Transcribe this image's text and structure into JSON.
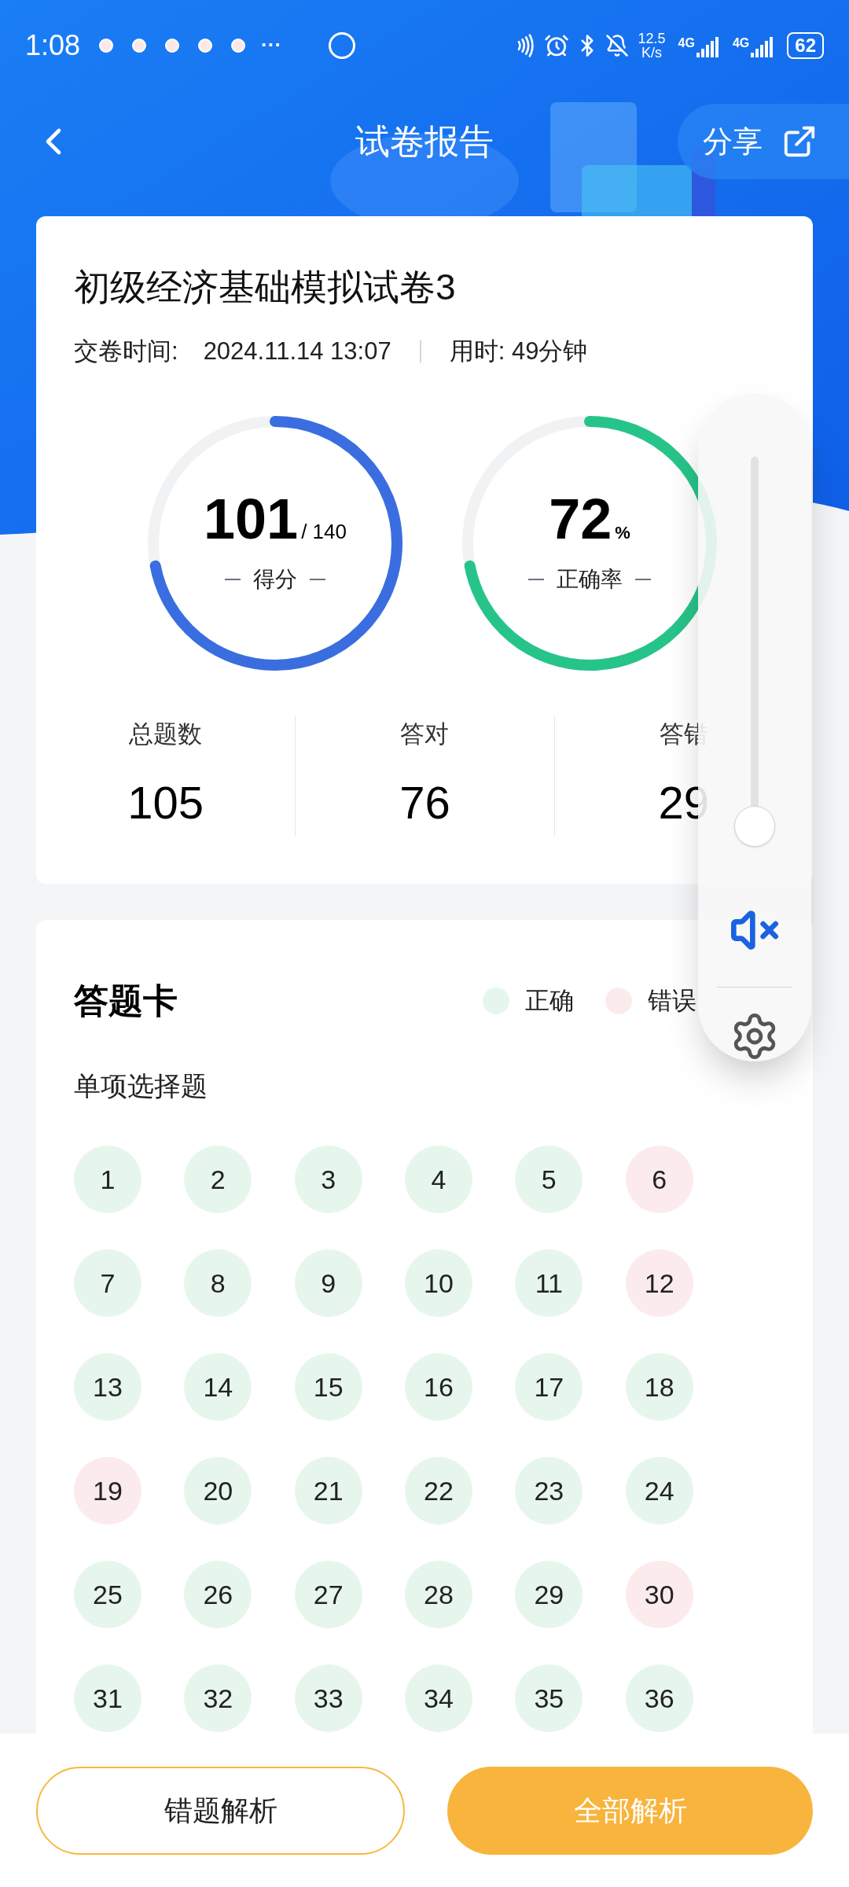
{
  "status_bar": {
    "time": "1:08",
    "more": "···",
    "speed_value": "12.5",
    "speed_unit": "K/s",
    "networks": [
      "4G",
      "4G"
    ],
    "battery": "62"
  },
  "header": {
    "title": "试卷报告",
    "share": "分享"
  },
  "report": {
    "title": "初级经济基础模拟试卷3",
    "submit_label": "交卷时间:",
    "submit_time": "2024.11.14 13:07",
    "duration": "用时: 49分钟",
    "rings": [
      {
        "kind": "score",
        "value": "101",
        "suffix": "/ 140",
        "label": "得分",
        "level": 0.72,
        "color": "#3a6ee0"
      },
      {
        "kind": "rate",
        "value": "72",
        "suffix": "%",
        "label": "正确率",
        "level": 0.72,
        "color": "#27c48a"
      }
    ],
    "stats": [
      {
        "label": "总题数",
        "value": "105"
      },
      {
        "label": "答对",
        "value": "76"
      },
      {
        "label": "答错",
        "value": "29"
      }
    ]
  },
  "answer_card": {
    "title": "答题卡",
    "legend": [
      {
        "label": "正确",
        "color": "#e6f6ec"
      },
      {
        "label": "错误",
        "color": "#fcebec"
      }
    ],
    "section": "单项选择题",
    "questions": [
      {
        "n": "1",
        "correct": true
      },
      {
        "n": "2",
        "correct": true
      },
      {
        "n": "3",
        "correct": true
      },
      {
        "n": "4",
        "correct": true
      },
      {
        "n": "5",
        "correct": true
      },
      {
        "n": "6",
        "correct": false
      },
      {
        "n": "7",
        "correct": true
      },
      {
        "n": "8",
        "correct": true
      },
      {
        "n": "9",
        "correct": true
      },
      {
        "n": "10",
        "correct": true
      },
      {
        "n": "11",
        "correct": true
      },
      {
        "n": "12",
        "correct": false
      },
      {
        "n": "13",
        "correct": true
      },
      {
        "n": "14",
        "correct": true
      },
      {
        "n": "15",
        "correct": true
      },
      {
        "n": "16",
        "correct": true
      },
      {
        "n": "17",
        "correct": true
      },
      {
        "n": "18",
        "correct": true
      },
      {
        "n": "19",
        "correct": false
      },
      {
        "n": "20",
        "correct": true
      },
      {
        "n": "21",
        "correct": true
      },
      {
        "n": "22",
        "correct": true
      },
      {
        "n": "23",
        "correct": true
      },
      {
        "n": "24",
        "correct": true
      },
      {
        "n": "25",
        "correct": true
      },
      {
        "n": "26",
        "correct": true
      },
      {
        "n": "27",
        "correct": true
      },
      {
        "n": "28",
        "correct": true
      },
      {
        "n": "29",
        "correct": true
      },
      {
        "n": "30",
        "correct": false
      },
      {
        "n": "31",
        "correct": true
      },
      {
        "n": "32",
        "correct": true
      },
      {
        "n": "33",
        "correct": true
      },
      {
        "n": "34",
        "correct": true
      },
      {
        "n": "35",
        "correct": true
      },
      {
        "n": "36",
        "correct": true
      }
    ]
  },
  "volume_panel": {
    "level": 0.03,
    "muted": true
  },
  "buttons": [
    {
      "kind": "outline",
      "label": "错题解析"
    },
    {
      "kind": "filled",
      "label": "全部解析"
    }
  ]
}
